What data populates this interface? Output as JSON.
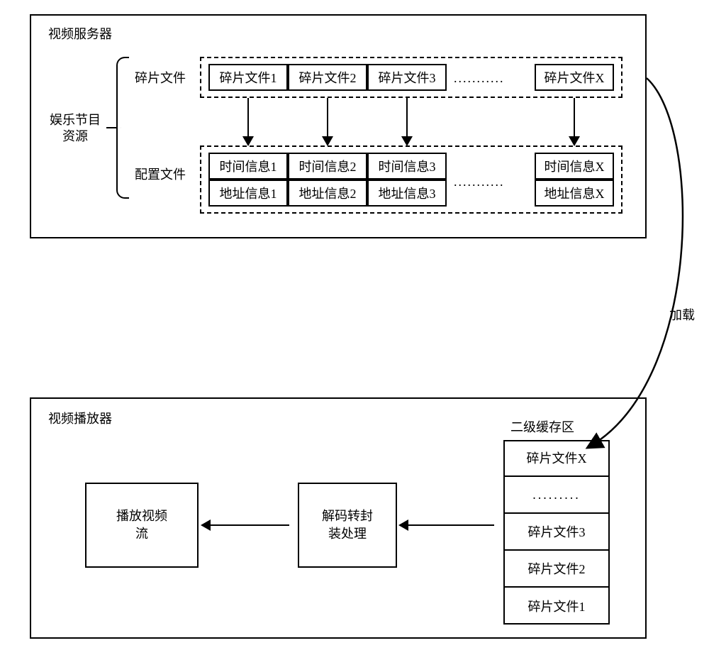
{
  "server": {
    "title": "视频服务器",
    "resource_label": "娱乐节目\n资源",
    "fragments_label": "碎片文件",
    "config_label": "配置文件",
    "fragments": [
      "碎片文件1",
      "碎片文件2",
      "碎片文件3",
      "碎片文件X"
    ],
    "config": {
      "time": [
        "时间信息1",
        "时间信息2",
        "时间信息3",
        "时间信息X"
      ],
      "addr": [
        "地址信息1",
        "地址信息2",
        "地址信息3",
        "地址信息X"
      ]
    },
    "ellipsis_top": "...........",
    "ellipsis_bottom": "..........."
  },
  "link_label": "加载",
  "player": {
    "title": "视频播放器",
    "cache_label": "二级缓存区",
    "cache_items": [
      "碎片文件X",
      ".........",
      "碎片文件3",
      "碎片文件2",
      "碎片文件1"
    ],
    "decode_box": "解码转封\n装处理",
    "play_box": "播放视频\n流"
  }
}
